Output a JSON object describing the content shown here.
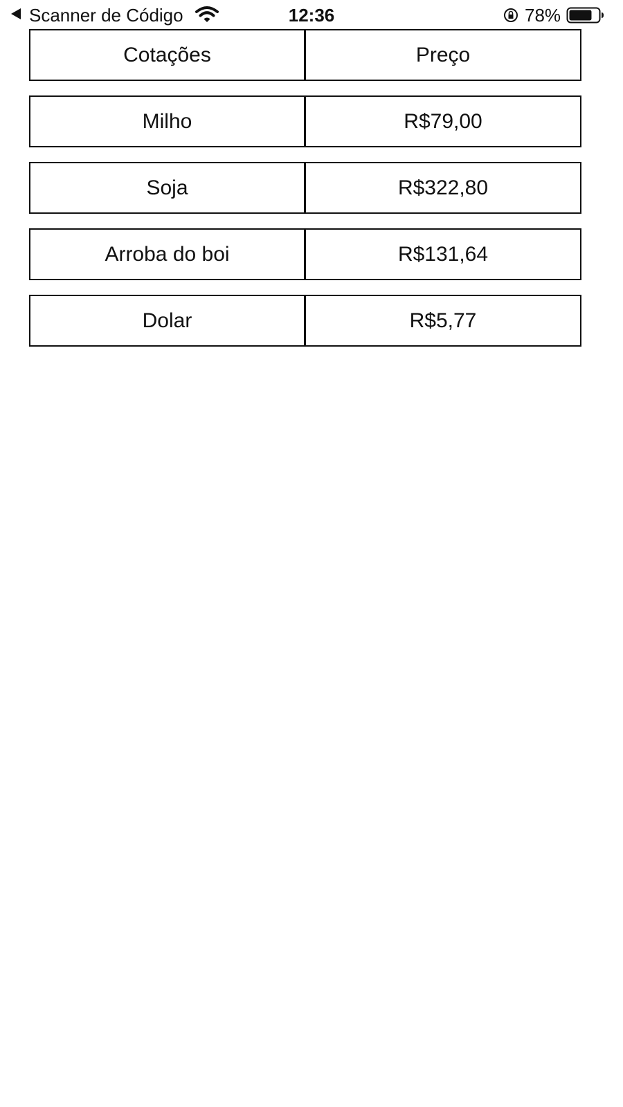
{
  "status_bar": {
    "back_app_label": "Scanner de Código",
    "time": "12:36",
    "battery_percent": "78%",
    "battery_level": 0.78,
    "icons": [
      "back-arrow-icon",
      "wifi-icon",
      "orientation-lock-icon",
      "battery-icon"
    ]
  },
  "table": {
    "header": {
      "col1": "Cotações",
      "col2": "Preço"
    },
    "rows": [
      {
        "name": "Milho",
        "price": "R$79,00"
      },
      {
        "name": "Soja",
        "price": "R$322,80"
      },
      {
        "name": "Arroba do boi",
        "price": "R$131,64"
      },
      {
        "name": "Dolar",
        "price": "R$5,77"
      }
    ]
  },
  "colors": {
    "text": "#111111",
    "border": "#111111",
    "background": "#ffffff"
  }
}
